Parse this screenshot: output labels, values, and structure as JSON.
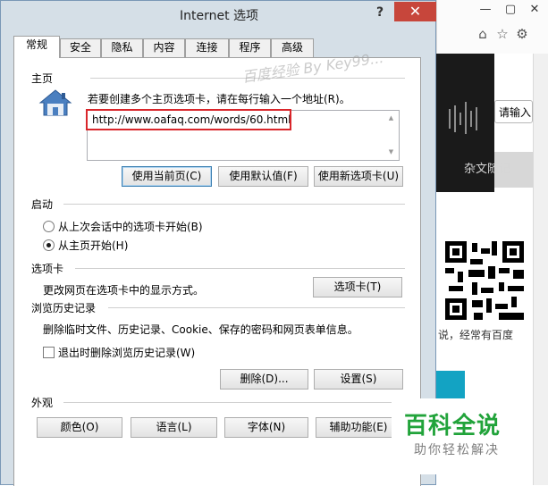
{
  "background_page": {
    "search_placeholder": "请输入",
    "link_text": "杂文随记",
    "snippet_text": "说，经常有百度",
    "window_controls": [
      "—",
      "▢",
      "✕"
    ],
    "toolbar_icons": [
      "home-icon",
      "star-icon",
      "gear-icon"
    ]
  },
  "dialog": {
    "title": "Internet 选项",
    "help_label": "?",
    "close_label": "✕",
    "tabs": [
      {
        "label": "常规",
        "active": true
      },
      {
        "label": "安全",
        "active": false
      },
      {
        "label": "隐私",
        "active": false
      },
      {
        "label": "内容",
        "active": false
      },
      {
        "label": "连接",
        "active": false
      },
      {
        "label": "程序",
        "active": false
      },
      {
        "label": "高级",
        "active": false
      }
    ],
    "homepage": {
      "label": "主页",
      "instruction": "若要创建多个主页选项卡，请在每行输入一个地址(R)。",
      "url": "http://www.oafaq.com/words/60.html",
      "buttons": [
        "使用当前页(C)",
        "使用默认值(F)",
        "使用新选项卡(U)"
      ]
    },
    "startup": {
      "label": "启动",
      "options": [
        {
          "label": "从上次会话中的选项卡开始(B)",
          "selected": false
        },
        {
          "label": "从主页开始(H)",
          "selected": true
        }
      ]
    },
    "tabs_section": {
      "label": "选项卡",
      "description": "更改网页在选项卡中的显示方式。",
      "button": "选项卡(T)"
    },
    "history": {
      "label": "浏览历史记录",
      "description": "删除临时文件、历史记录、Cookie、保存的密码和网页表单信息。",
      "checkbox_label": "退出时删除浏览历史记录(W)",
      "checkbox_checked": false,
      "delete_button": "删除(D)...",
      "settings_button": "设置(S)"
    },
    "appearance": {
      "label": "外观",
      "buttons": [
        "颜色(O)",
        "语言(L)",
        "字体(N)",
        "辅助功能(E)"
      ]
    }
  },
  "watermark": "百度经验 By Key99...",
  "overlay_logo": {
    "title": "百科全说",
    "subtitle": "助你轻松解决"
  },
  "colors": {
    "dialog_frame": "#d5dfe7",
    "close_button": "#c7463b",
    "url_highlight": "#d9262b",
    "logo_green": "#21a33a",
    "teal": "#13a3c3"
  }
}
